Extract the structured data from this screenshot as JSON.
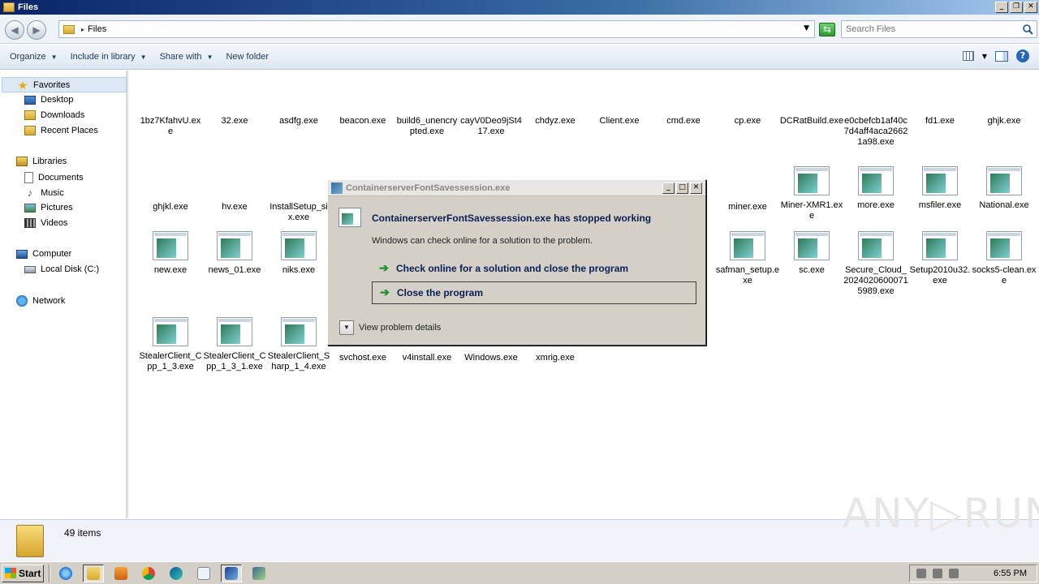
{
  "window": {
    "title": "Files"
  },
  "address": {
    "crumb": "Files",
    "search_placeholder": "Search Files"
  },
  "toolbar": {
    "organize": "Organize",
    "include_in_library": "Include in library",
    "share_with": "Share with",
    "new_folder": "New folder"
  },
  "nav": {
    "favorites": "Favorites",
    "desktop": "Desktop",
    "downloads": "Downloads",
    "recent_places": "Recent Places",
    "libraries": "Libraries",
    "documents": "Documents",
    "music": "Music",
    "pictures": "Pictures",
    "videos": "Videos",
    "computer": "Computer",
    "local_disk": "Local Disk (C:)",
    "network": "Network"
  },
  "files": {
    "r1": [
      "1bz7KfahvU.exe",
      "32.exe",
      "asdfg.exe",
      "beacon.exe",
      "build6_unencrypted.exe",
      "cayV0Deo9jSt417.exe",
      "chdyz.exe",
      "Client.exe",
      "cmd.exe",
      "cp.exe",
      "DCRatBuild.exe",
      "e0cbefcb1af40c7d4aff4aca26621a98.exe",
      "fd1.exe",
      "ghjk.exe"
    ],
    "r2": [
      "ghjkl.exe",
      "hv.exe",
      "InstallSetup_six.exe",
      "miner.exe",
      "Miner-XMR1.exe",
      "more.exe",
      "msfiler.exe",
      "National.exe"
    ],
    "r3": [
      "new.exe",
      "news_01.exe",
      "niks.exe",
      "safman_setup.exe",
      "sc.exe",
      "Secure_Cloud_20240206000715989.exe",
      "Setup2010u32.exe",
      "socks5-clean.exe"
    ],
    "r4": [
      "StealerClient_Cpp_1_3.exe",
      "StealerClient_Cpp_1_3_1.exe",
      "StealerClient_Sharp_1_4.exe",
      "svchost.exe",
      "v4install.exe",
      "Windows.exe",
      "xmrig.exe"
    ]
  },
  "status": {
    "count": "49 items"
  },
  "dialog": {
    "title": "ContainerserverFontSavessession.exe",
    "heading": "ContainerserverFontSavessession.exe has stopped working",
    "subtext": "Windows can check online for a solution to the problem.",
    "option_check": "Check online for a solution and close the program",
    "option_close": "Close the program",
    "details": "View problem details"
  },
  "taskbar": {
    "start": "Start",
    "clock": "6:55 PM"
  },
  "watermark": "ANY RUN",
  "colors": {
    "titlebar": "#0a246a",
    "dialog_bg": "#d4d0c8",
    "accent_green": "#1f8f2a"
  }
}
